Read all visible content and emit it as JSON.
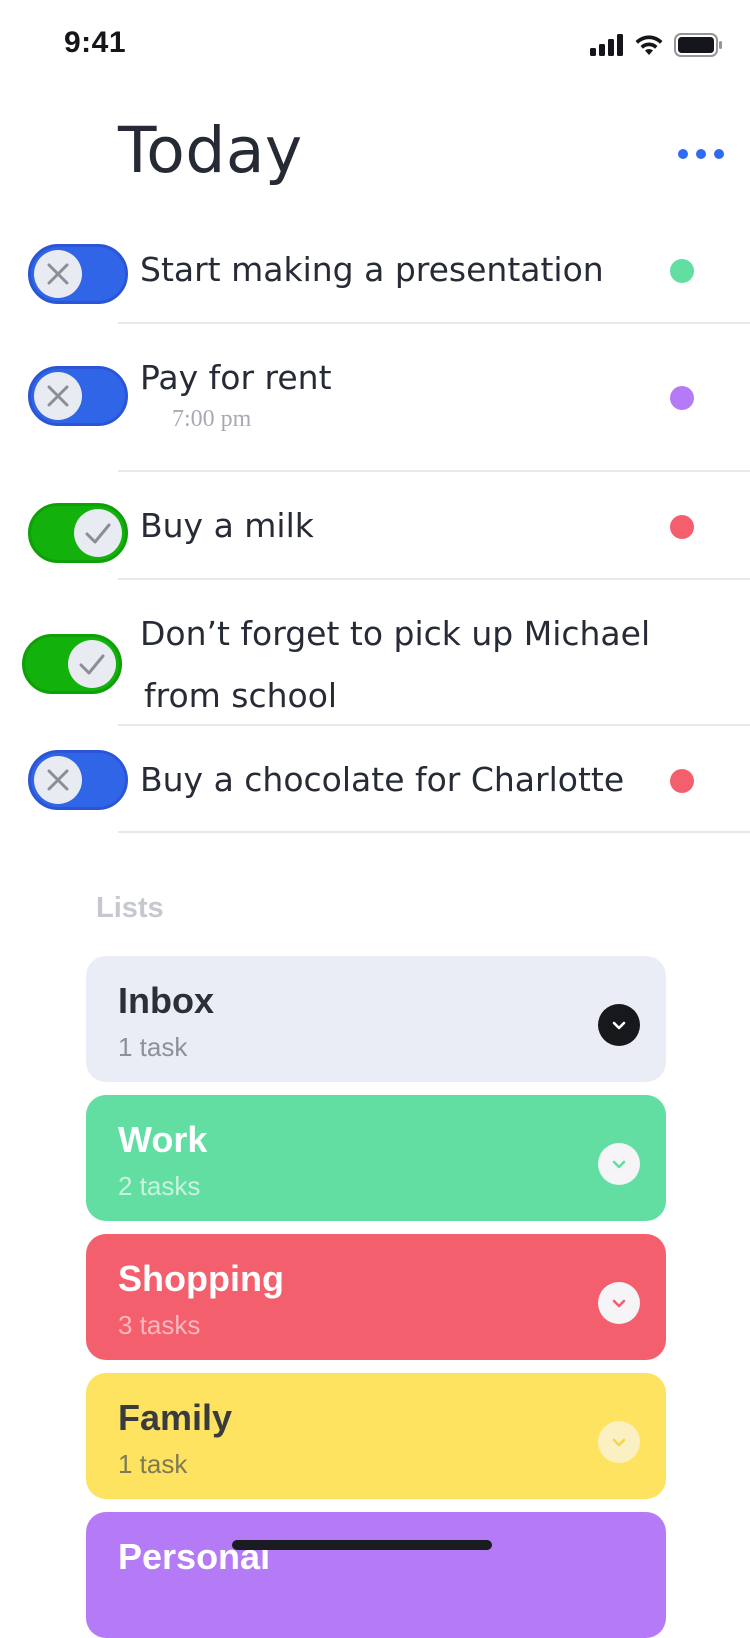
{
  "status_bar": {
    "time": "9:41"
  },
  "header": {
    "title": "Today"
  },
  "icons": {
    "more": "more-dots-icon",
    "signal": "signal-icon",
    "wifi": "wifi-icon",
    "battery": "battery-icon",
    "unchecked": "close-icon",
    "checked": "check-icon",
    "expand": "chevron-down-icon"
  },
  "colors": {
    "accent": "#2f6bf2",
    "toggle_off": "#3065e8",
    "toggle_on": "#13b10b"
  },
  "tasks": [
    {
      "text": "Start making a presentation",
      "done": false,
      "dot_color": "#62dea3"
    },
    {
      "text": "Pay for rent",
      "time": "7:00 pm",
      "done": false,
      "dot_color": "#b57bf6"
    },
    {
      "text": "Buy a milk",
      "done": true,
      "dot_color": "#f45f6d"
    },
    {
      "text_line1": "Don’t forget to pick up Michael",
      "text_line2": "from school",
      "done": true
    },
    {
      "text": "Buy a chocolate for Charlotte",
      "done": false,
      "dot_color": "#f45f6d"
    }
  ],
  "lists": {
    "heading": "Lists",
    "items": [
      {
        "name": "Inbox",
        "count": "1 task",
        "color": "#eaedf5"
      },
      {
        "name": "Work",
        "count": "2 tasks",
        "color": "#62dea3"
      },
      {
        "name": "Shopping",
        "count": "3 tasks",
        "color": "#f45f6d"
      },
      {
        "name": "Family",
        "count": "1 task",
        "color": "#fde35f"
      },
      {
        "name": "Personal",
        "color": "#b57bf6"
      }
    ]
  }
}
